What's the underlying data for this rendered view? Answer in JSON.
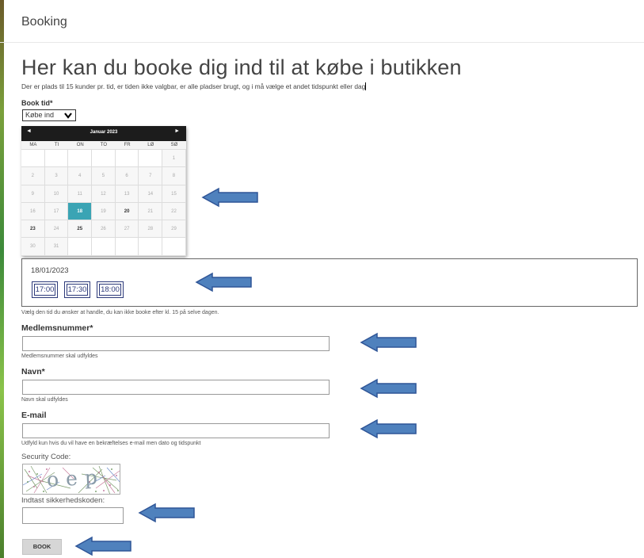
{
  "header": {
    "title": "Booking"
  },
  "page": {
    "title": "Her kan du booke dig ind til at købe i butikken",
    "intro": "Der er plads til 15 kunder pr. tid, er tiden ikke valgbar, er alle pladser brugt, og i må vælge et andet tidspunkt eller dag"
  },
  "booking": {
    "label": "Book tid*",
    "select_value": "Købe ind"
  },
  "calendar": {
    "month": "Januar 2023",
    "prev": "◄",
    "next": "►",
    "weekdays": [
      "MA",
      "TI",
      "ON",
      "TO",
      "FR",
      "LØ",
      "SØ"
    ],
    "selected_day": 18,
    "bold_days": [
      20,
      23,
      25
    ],
    "rows": [
      [
        "",
        "",
        "",
        "",
        "",
        "",
        "1"
      ],
      [
        "2",
        "3",
        "4",
        "5",
        "6",
        "7",
        "8"
      ],
      [
        "9",
        "10",
        "11",
        "12",
        "13",
        "14",
        "15"
      ],
      [
        "16",
        "17",
        "18",
        "19",
        "20",
        "21",
        "22"
      ],
      [
        "23",
        "24",
        "25",
        "26",
        "27",
        "28",
        "29"
      ],
      [
        "30",
        "31",
        "",
        "",
        "",
        "",
        ""
      ]
    ]
  },
  "times": {
    "date": "18/01/2023",
    "slots": [
      "17:00",
      "17:30",
      "18:00"
    ],
    "hint": "Vælg den tid du ønsker at handle, du kan ikke booke efter kl. 15 på selve dagen."
  },
  "fields": {
    "member_label": "Medlemsnummer*",
    "member_hint": "Medlemsnummer skal udfyldes",
    "name_label": "Navn*",
    "name_hint": "Navn skal udfyldes",
    "email_label": "E-mail",
    "email_hint": "Udfyld kun hvis du vil have en bekræftelses e-mail men dato og tidspunkt"
  },
  "captcha": {
    "label": "Security Code:",
    "text": "oep",
    "input_label": "Indtast sikkerhedskoden:"
  },
  "submit": {
    "label": "BOOK"
  },
  "colors": {
    "accent": "#3aa4b4",
    "arrow_fill": "#4f81bd",
    "arrow_stroke": "#2f5597",
    "time_border": "#2d3a7a"
  }
}
